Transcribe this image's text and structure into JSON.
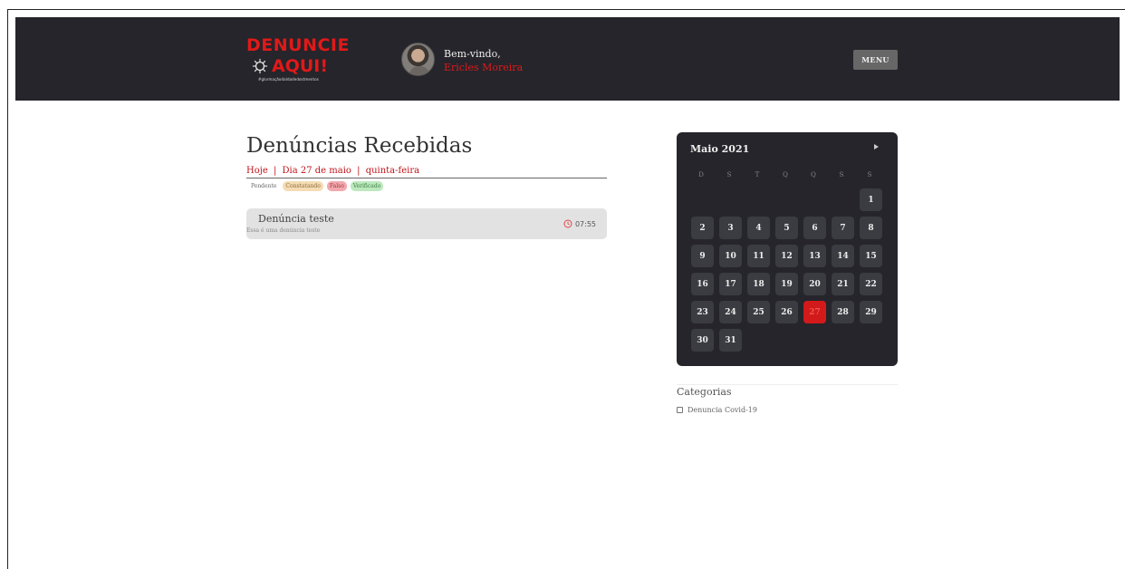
{
  "header": {
    "logo": {
      "line1": "DENUNCIE",
      "line2": "AQUI!",
      "tagline": "#glormaçãodaIdadedostmentos"
    },
    "welcome": "Bem-vindo,",
    "user_name": "Ericles Moreira",
    "menu_label": "MENU"
  },
  "main": {
    "title": "Denúncias Recebidas",
    "date": {
      "today": "Hoje",
      "day": "Dia 27 de maio",
      "weekday": "quinta-feira",
      "separator": "|"
    },
    "legend": [
      "Pendente",
      "Constatando",
      "Falso",
      "Verificado"
    ],
    "reports": [
      {
        "title": "Denúncia teste",
        "description": "Essa é uma denúncia teste",
        "time": "07:55"
      }
    ]
  },
  "calendar": {
    "month": "Maio 2021",
    "weekdays": [
      "D",
      "S",
      "T",
      "Q",
      "Q",
      "S",
      "S"
    ],
    "days": [
      "1",
      "2",
      "3",
      "4",
      "5",
      "6",
      "7",
      "8",
      "9",
      "10",
      "11",
      "12",
      "13",
      "14",
      "15",
      "16",
      "17",
      "18",
      "19",
      "20",
      "21",
      "22",
      "23",
      "24",
      "25",
      "26",
      "27",
      "28",
      "29",
      "30",
      "31"
    ],
    "today": "27",
    "colors": {
      "background": "#25252b",
      "cell": "#3b3b42",
      "today": "#d21a1a"
    }
  },
  "sidebar": {
    "categories_title": "Categorias",
    "categories": [
      "Denuncia Covid-19"
    ]
  },
  "colors": {
    "accent": "#e01919",
    "topbar": "#25252b"
  }
}
